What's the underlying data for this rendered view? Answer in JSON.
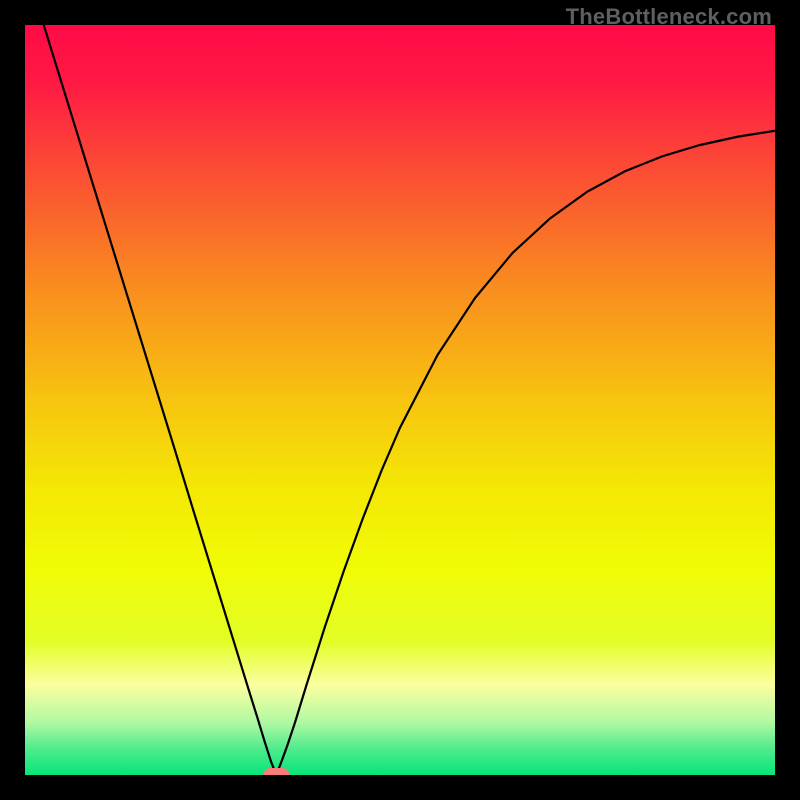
{
  "watermark": "TheBottleneck.com",
  "chart_data": {
    "type": "line",
    "title": "",
    "xlabel": "",
    "ylabel": "",
    "xlim": [
      0,
      100
    ],
    "ylim": [
      0,
      100
    ],
    "background_gradient": {
      "stops": [
        {
          "offset": 0.0,
          "color": "#ff0a46"
        },
        {
          "offset": 0.08,
          "color": "#ff1b44"
        },
        {
          "offset": 0.2,
          "color": "#fb4f33"
        },
        {
          "offset": 0.35,
          "color": "#f98d1f"
        },
        {
          "offset": 0.5,
          "color": "#f7c40f"
        },
        {
          "offset": 0.62,
          "color": "#f4e805"
        },
        {
          "offset": 0.72,
          "color": "#f1fb05"
        },
        {
          "offset": 0.82,
          "color": "#e2fd24"
        },
        {
          "offset": 0.88,
          "color": "#fbffa0"
        },
        {
          "offset": 0.93,
          "color": "#b0f9a2"
        },
        {
          "offset": 0.965,
          "color": "#4feb8c"
        },
        {
          "offset": 1.0,
          "color": "#05e579"
        }
      ]
    },
    "series": [
      {
        "name": "bottleneck-curve",
        "color": "#000000",
        "x": [
          2.5,
          5,
          7.5,
          10,
          12.5,
          15,
          17.5,
          20,
          22.5,
          25,
          27.5,
          30,
          31,
          32,
          32.8,
          33.5,
          34.2,
          35,
          36,
          37.5,
          40,
          42.5,
          45,
          47.5,
          50,
          55,
          60,
          65,
          70,
          75,
          80,
          85,
          90,
          95,
          100
        ],
        "y": [
          100,
          91.9,
          83.8,
          75.7,
          67.6,
          59.5,
          51.4,
          43.3,
          35.1,
          27.0,
          18.9,
          10.8,
          7.6,
          4.3,
          1.8,
          0.0,
          1.8,
          4.0,
          7.0,
          11.9,
          19.8,
          27.2,
          34.1,
          40.5,
          46.3,
          56.0,
          63.6,
          69.6,
          74.2,
          77.8,
          80.5,
          82.5,
          84.0,
          85.1,
          85.9
        ]
      }
    ],
    "marker": {
      "x": 33.5,
      "y": 0.0,
      "color": "#ff7b7b",
      "shape": "pill"
    }
  }
}
